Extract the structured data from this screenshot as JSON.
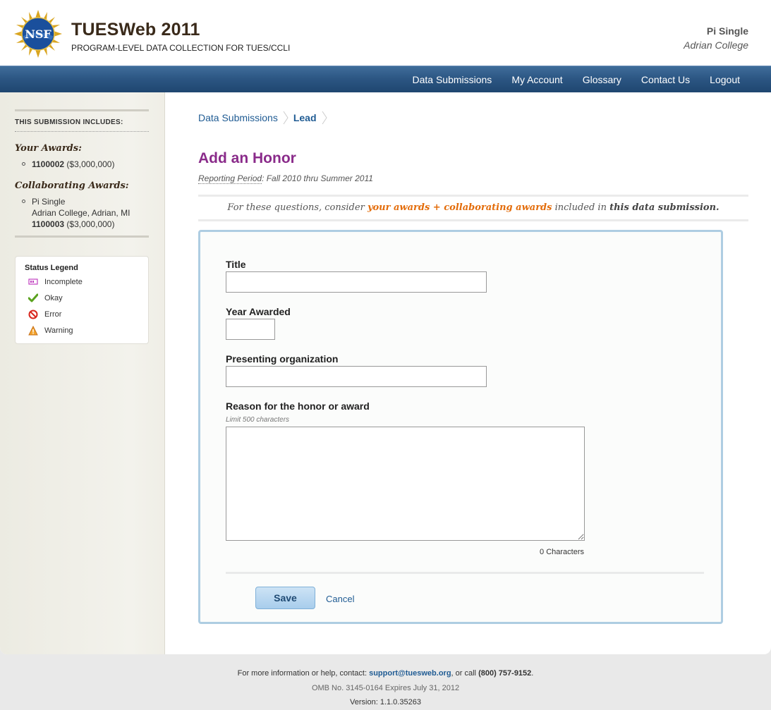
{
  "header": {
    "app_title": "TUESWeb 2011",
    "app_subtitle": "PROGRAM-LEVEL DATA COLLECTION FOR TUES/CCLI",
    "logo_text": "NSF",
    "user_name": "Pi Single",
    "user_org": "Adrian College"
  },
  "nav": {
    "items": [
      "Data Submissions",
      "My Account",
      "Glossary",
      "Contact Us",
      "Logout"
    ]
  },
  "sidebar": {
    "heading": "THIS SUBMISSION INCLUDES:",
    "your_awards_label": "Your Awards:",
    "your_awards": [
      {
        "id": "1100002",
        "amount": "($3,000,000)"
      }
    ],
    "collab_awards_label": "Collaborating Awards:",
    "collab_awards": [
      {
        "name": "Pi Single",
        "location": "Adrian College, Adrian, MI",
        "id": "1100003",
        "amount": "($3,000,000)"
      }
    ],
    "legend": {
      "title": "Status Legend",
      "items": [
        {
          "label": "Incomplete",
          "icon": "incomplete-icon",
          "color": "#c040c0"
        },
        {
          "label": "Okay",
          "icon": "check-icon",
          "color": "#5aa21e"
        },
        {
          "label": "Error",
          "icon": "error-icon",
          "color": "#d8261e"
        },
        {
          "label": "Warning",
          "icon": "warning-icon",
          "color": "#e88a1a"
        }
      ]
    }
  },
  "breadcrumb": {
    "items": [
      "Data Submissions",
      "Lead"
    ]
  },
  "page": {
    "title": "Add an Honor",
    "period_label": "Reporting Period",
    "period_value": ": Fall 2010 thru Summer 2011",
    "notice": {
      "pre": "For these questions, consider ",
      "highlight": "your awards + collaborating awards",
      "mid": " included in ",
      "strong": "this data submission."
    }
  },
  "form": {
    "title_label": "Title",
    "title_value": "",
    "year_label": "Year Awarded",
    "year_value": "",
    "org_label": "Presenting organization",
    "org_value": "",
    "reason_label": "Reason for the honor or award",
    "reason_hint": "Limit 500 characters",
    "reason_value": "",
    "char_count": "0 Characters",
    "save_label": "Save",
    "cancel_label": "Cancel"
  },
  "footer": {
    "help_pre": "For more information or help, contact: ",
    "email": "support@tuesweb.org",
    "help_mid": ", or call ",
    "phone": "(800) 757-9152",
    "help_end": ".",
    "omb": "OMB No. 3145-0164 Expires July 31, 2012",
    "version": "Version: 1.1.0.35263"
  },
  "colors": {
    "nav_bg": "#2b5582",
    "title_purple": "#8a2b8a",
    "link_blue": "#1f5b93",
    "highlight_orange": "#e36c0a",
    "form_border": "#aecde2"
  }
}
